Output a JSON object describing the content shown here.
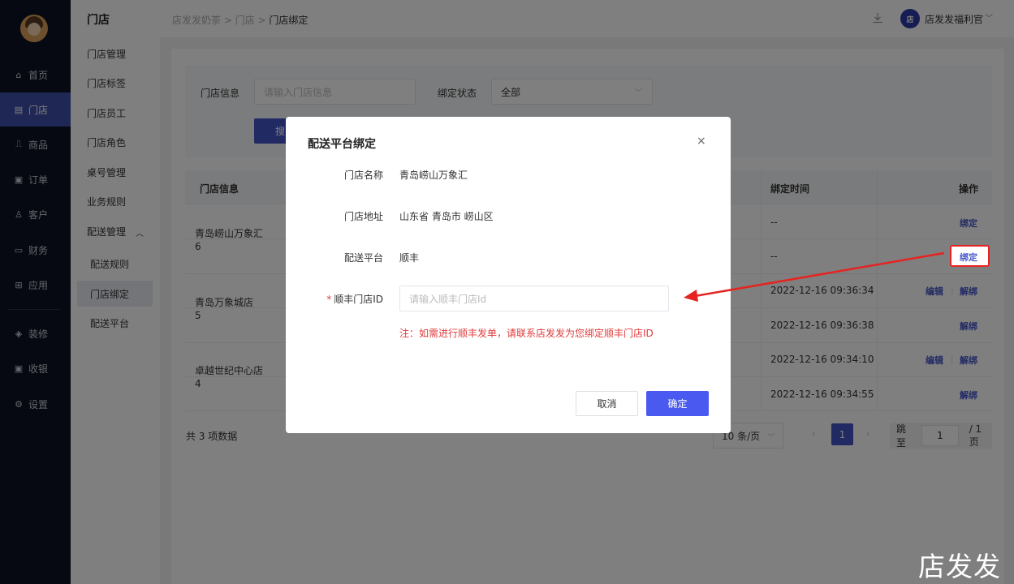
{
  "nav": {
    "items": [
      {
        "icon": "home-icon",
        "glyph": "⌂",
        "label": "首页"
      },
      {
        "icon": "store-icon",
        "glyph": "▤",
        "label": "门店",
        "active": true
      },
      {
        "icon": "bag-icon",
        "glyph": "⎍",
        "label": "商品"
      },
      {
        "icon": "order-icon",
        "glyph": "▣",
        "label": "订单"
      },
      {
        "icon": "user-icon",
        "glyph": "♙",
        "label": "客户"
      },
      {
        "icon": "wallet-icon",
        "glyph": "▭",
        "label": "财务"
      },
      {
        "icon": "apps-icon",
        "glyph": "⊞",
        "label": "应用"
      },
      {
        "icon": "layers-icon",
        "glyph": "◈",
        "label": "装修"
      },
      {
        "icon": "cashier-icon",
        "glyph": "▣",
        "label": "收银"
      },
      {
        "icon": "gear-icon",
        "glyph": "⚙",
        "label": "设置"
      }
    ]
  },
  "submenu": {
    "title": "门店",
    "items": [
      "门店管理",
      "门店标签",
      "门店员工",
      "门店角色",
      "桌号管理",
      "业务规则",
      "配送管理"
    ],
    "children": [
      "配送规则",
      "门店绑定",
      "配送平台"
    ]
  },
  "header": {
    "crumbs": [
      "店发发奶茶",
      " > ",
      "门店",
      " > "
    ],
    "current": "门店绑定",
    "logo_text": "店",
    "user": "店发发福利官"
  },
  "filter": {
    "store_label": "门店信息",
    "store_placeholder": "请输入门店信息",
    "status_label": "绑定状态",
    "status_value": "全部",
    "search_btn": "搜"
  },
  "table": {
    "col_store": "门店信息",
    "col_time": "绑定时间",
    "col_action": "操作",
    "stores": [
      {
        "name": "青岛崂山万象汇",
        "num": "6"
      },
      {
        "name": "青岛万象城店",
        "num": "5"
      },
      {
        "name": "卓越世纪中心店",
        "num": "4"
      }
    ],
    "times": [
      "--",
      "--",
      "2022-12-16 09:36:34",
      "2022-12-16 09:36:38",
      "2022-12-16 09:34:10",
      "2022-12-16 09:34:55"
    ],
    "bind": "绑定",
    "edit": "编辑",
    "unbind": "解绑",
    "sep": "|"
  },
  "pager": {
    "total": "共 3 项数据",
    "size": "10 条/页",
    "current": "1",
    "jump_label": "跳至",
    "jump_value": "1",
    "pages": "/ 1 页"
  },
  "modal": {
    "title": "配送平台绑定",
    "close": "×",
    "name_label": "门店名称",
    "name_value": "青岛崂山万象汇",
    "addr_label": "门店地址",
    "addr_value": "山东省 青岛市 崂山区",
    "platform_label": "配送平台",
    "platform_value": "顺丰",
    "required_mark": "*",
    "id_label": "顺丰门店ID",
    "id_placeholder": "请输入顺丰门店Id",
    "note": "注：如需进行顺丰发单，请联系店发发为您绑定顺丰门店ID",
    "cancel": "取消",
    "ok": "确定"
  },
  "watermark": "店发发",
  "colors": {
    "accent": "#4455c8",
    "primary_button": "#4a5af0",
    "annotation": "#e52421",
    "nav_bg": "#0f1325"
  }
}
